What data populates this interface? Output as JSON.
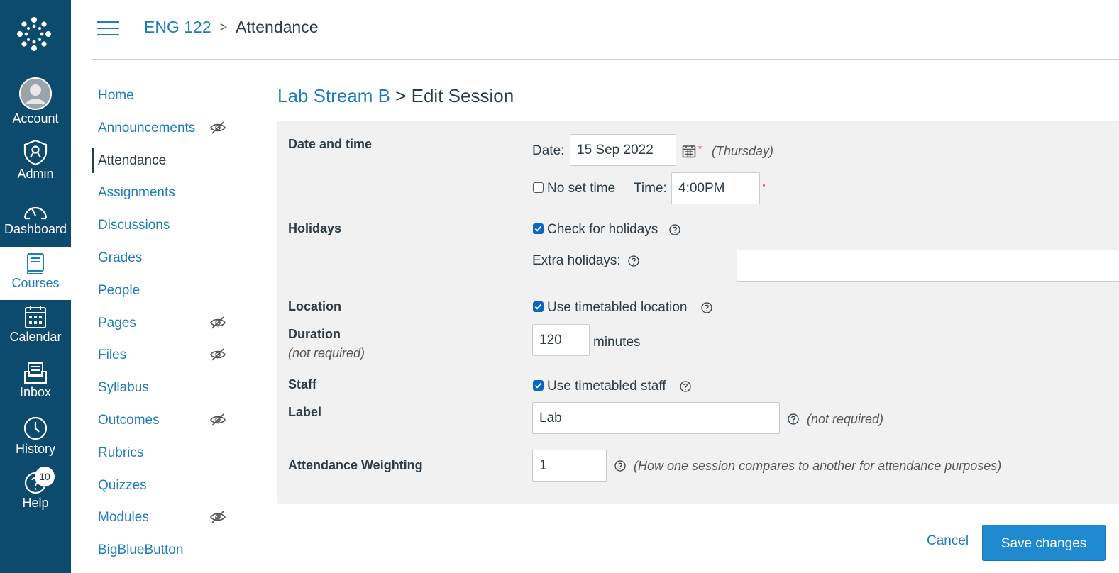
{
  "global_nav": {
    "items": [
      {
        "label": "Account",
        "icon": "avatar-icon"
      },
      {
        "label": "Admin",
        "icon": "admin-shield-icon"
      },
      {
        "label": "Dashboard",
        "icon": "dashboard-icon"
      },
      {
        "label": "Courses",
        "icon": "book-icon"
      },
      {
        "label": "Calendar",
        "icon": "calendar-icon"
      },
      {
        "label": "Inbox",
        "icon": "inbox-icon"
      },
      {
        "label": "History",
        "icon": "clock-icon"
      },
      {
        "label": "Help",
        "icon": "help-icon"
      }
    ],
    "help_badge": "10",
    "active": "Courses"
  },
  "header": {
    "course": "ENG 122",
    "separator": ">",
    "current": "Attendance"
  },
  "course_nav": {
    "items": [
      {
        "label": "Home",
        "hidden": false
      },
      {
        "label": "Announcements",
        "hidden": true
      },
      {
        "label": "Attendance",
        "hidden": false
      },
      {
        "label": "Assignments",
        "hidden": false
      },
      {
        "label": "Discussions",
        "hidden": false
      },
      {
        "label": "Grades",
        "hidden": false
      },
      {
        "label": "People",
        "hidden": false
      },
      {
        "label": "Pages",
        "hidden": true
      },
      {
        "label": "Files",
        "hidden": true
      },
      {
        "label": "Syllabus",
        "hidden": false
      },
      {
        "label": "Outcomes",
        "hidden": true
      },
      {
        "label": "Rubrics",
        "hidden": false
      },
      {
        "label": "Quizzes",
        "hidden": false
      },
      {
        "label": "Modules",
        "hidden": true
      },
      {
        "label": "BigBlueButton",
        "hidden": false
      }
    ],
    "active": "Attendance"
  },
  "page": {
    "title_link": "Lab Stream B",
    "title_rest": "> Edit Session"
  },
  "form": {
    "date_time_label": "Date and time",
    "date_label": "Date:",
    "date_value": "15 Sep 2022",
    "date_day": "(Thursday)",
    "no_set_time_label": "No set time",
    "no_set_time_checked": false,
    "time_label": "Time:",
    "time_value": "4:00PM",
    "required_mark": "*",
    "holidays_label": "Holidays",
    "check_holidays_label": "Check for holidays",
    "check_holidays_checked": true,
    "extra_holidays_label": "Extra holidays:",
    "extra_holidays_value": "",
    "location_label": "Location",
    "use_location_label": "Use timetabled location",
    "use_location_checked": true,
    "duration_label": "Duration",
    "duration_note": "(not required)",
    "duration_value": "120",
    "duration_unit": "minutes",
    "staff_label": "Staff",
    "use_staff_label": "Use timetabled staff",
    "use_staff_checked": true,
    "label_label": "Label",
    "label_value": "Lab",
    "label_note": "(not required)",
    "weighting_label": "Attendance Weighting",
    "weighting_value": "1",
    "weighting_note": "(How one session compares to another for attendance purposes)"
  },
  "actions": {
    "cancel": "Cancel",
    "save": "Save changes"
  },
  "colors": {
    "nav_bg": "#0d4b6e",
    "link": "#1f7dbf",
    "primary_button": "#1f8ad0",
    "panel_bg": "#f1f1f1",
    "required": "#c7253e"
  }
}
